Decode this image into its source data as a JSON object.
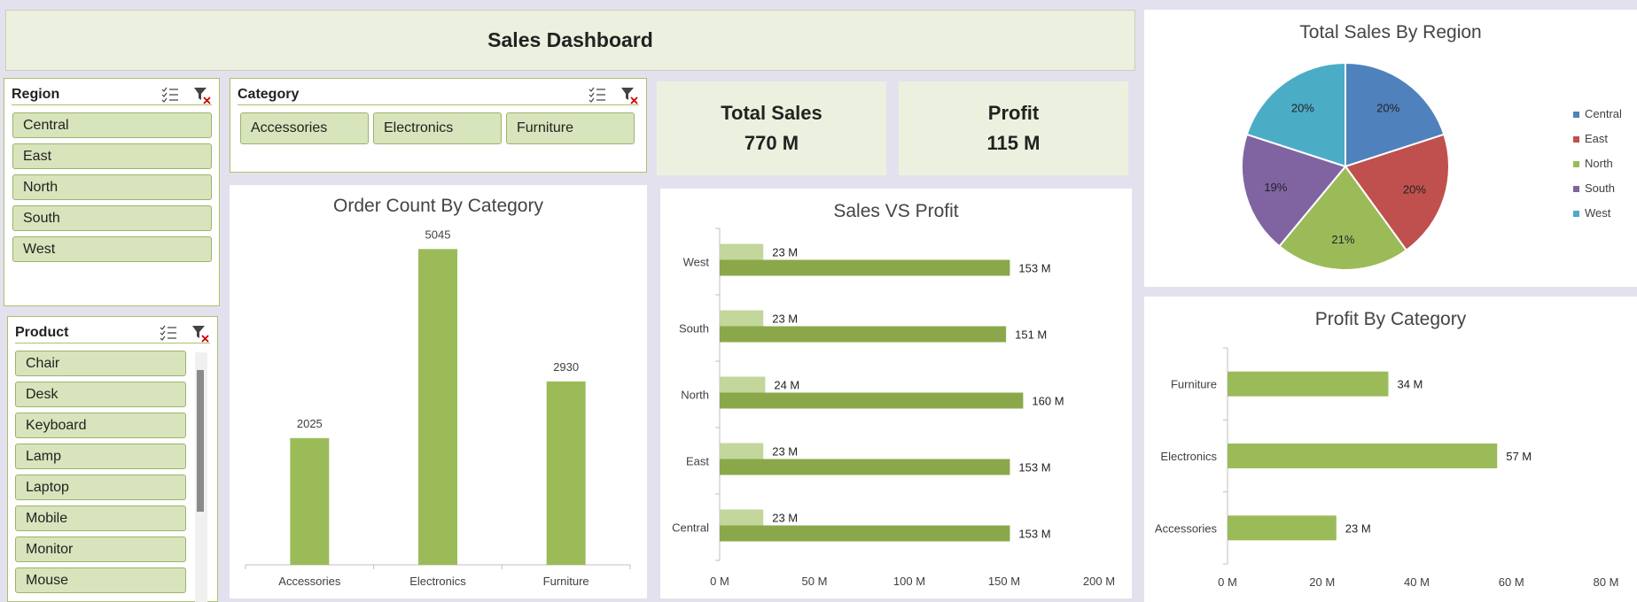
{
  "dashboard": {
    "title": "Sales Dashboard"
  },
  "colors": {
    "bar_green": "#9bbb59",
    "bar_light": "#c3d69b",
    "bar_dark": "#8aa84a",
    "slicer_item": "#d8e4bc",
    "kpi_bg": "#ebf1de"
  },
  "slicers": {
    "region": {
      "title": "Region",
      "items": [
        "Central",
        "East",
        "North",
        "South",
        "West"
      ],
      "icons": [
        "multi-select-icon",
        "clear-filter-icon"
      ]
    },
    "category": {
      "title": "Category",
      "items": [
        "Accessories",
        "Electronics",
        "Furniture"
      ],
      "icons": [
        "multi-select-icon",
        "clear-filter-icon"
      ]
    },
    "product": {
      "title": "Product",
      "items": [
        "Chair",
        "Desk",
        "Keyboard",
        "Lamp",
        "Laptop",
        "Mobile",
        "Monitor",
        "Mouse"
      ],
      "icons": [
        "multi-select-icon",
        "clear-filter-icon"
      ]
    }
  },
  "kpis": {
    "total_sales": {
      "label": "Total Sales",
      "value": "770 M"
    },
    "profit": {
      "label": "Profit",
      "value": "115 M"
    }
  },
  "chart_data": [
    {
      "id": "order_count",
      "type": "bar",
      "title": "Order Count By Category",
      "categories": [
        "Accessories",
        "Electronics",
        "Furniture"
      ],
      "values": [
        2025,
        5045,
        2930
      ],
      "ylim": [
        0,
        6000
      ],
      "grid": false
    },
    {
      "id": "sales_vs_profit",
      "type": "bar",
      "orientation": "horizontal",
      "title": "Sales VS Profit",
      "categories": [
        "West",
        "South",
        "North",
        "East",
        "Central"
      ],
      "series": [
        {
          "values": [
            23,
            23,
            24,
            23,
            23
          ],
          "labels": [
            "23 M",
            "23 M",
            "24 M",
            "23 M",
            "23 M"
          ],
          "color": "#c3d69b"
        },
        {
          "values": [
            153,
            151,
            160,
            153,
            153
          ],
          "labels": [
            "153 M",
            "151 M",
            "160 M",
            "153 M",
            "153 M"
          ],
          "color": "#8aa84a"
        }
      ],
      "xticks": [
        "0 M",
        "50 M",
        "100 M",
        "150 M",
        "200 M"
      ],
      "xlim": [
        0,
        200
      ]
    },
    {
      "id": "sales_by_region",
      "type": "pie",
      "title": "Total Sales By Region",
      "labels": [
        "Central",
        "East",
        "North",
        "South",
        "West"
      ],
      "values": [
        20,
        20,
        21,
        19,
        20
      ],
      "value_labels": [
        "20%",
        "20%",
        "21%",
        "19%",
        "20%"
      ],
      "colors": [
        "#4f81bd",
        "#c0504d",
        "#9bbb59",
        "#8064a2",
        "#4bacc6"
      ],
      "legend": "right"
    },
    {
      "id": "profit_by_category",
      "type": "bar",
      "orientation": "horizontal",
      "title": "Profit By Category",
      "categories": [
        "Furniture",
        "Electronics",
        "Accessories"
      ],
      "values": [
        34,
        57,
        23
      ],
      "value_labels": [
        "34 M",
        "57 M",
        "23 M"
      ],
      "xticks": [
        "0 M",
        "20 M",
        "40 M",
        "60 M",
        "80 M"
      ],
      "xlim": [
        0,
        80
      ]
    }
  ]
}
